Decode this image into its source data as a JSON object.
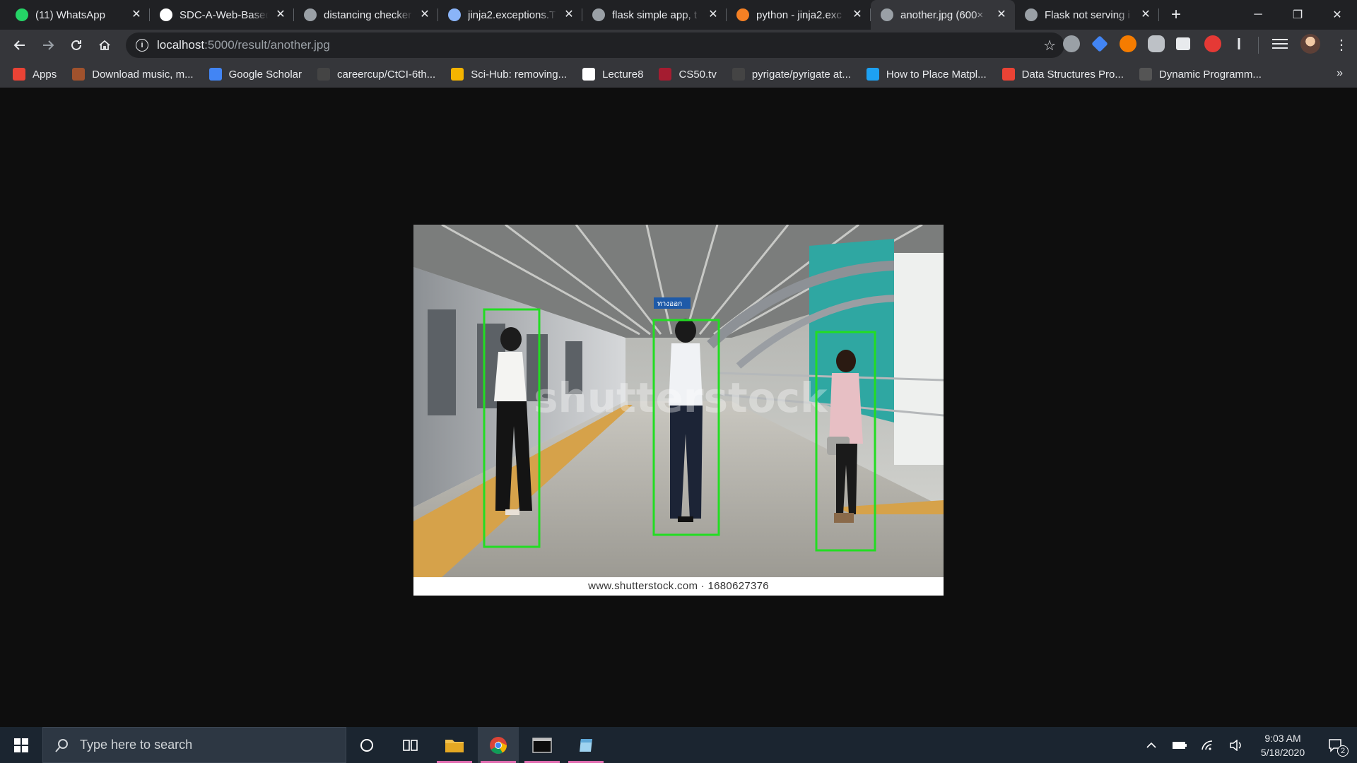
{
  "browser": {
    "tabs": [
      {
        "title": "(11) WhatsApp",
        "icon": "whatsapp-icon",
        "color": "#25d366"
      },
      {
        "title": "SDC-A-Web-Based",
        "icon": "github-icon",
        "color": "#ffffff"
      },
      {
        "title": "distancing checker",
        "icon": "globe-icon",
        "color": "#9aa0a6"
      },
      {
        "title": "jinja2.exceptions.T",
        "icon": "page-icon",
        "color": "#8ab4f8"
      },
      {
        "title": "flask simple app, t",
        "icon": "flask-icon",
        "color": "#9aa0a6"
      },
      {
        "title": "python - jinja2.exc",
        "icon": "stackoverflow-icon",
        "color": "#f48024"
      },
      {
        "title": "another.jpg (600×",
        "icon": "globe-icon",
        "color": "#9aa0a6",
        "active": true
      },
      {
        "title": "Flask not serving i",
        "icon": "flask-icon",
        "color": "#9aa0a6"
      }
    ],
    "new_tab": "+",
    "window_controls": {
      "minimize": "─",
      "restore": "❐",
      "close": "✕"
    },
    "address": {
      "host": "localhost",
      "path": ":5000/result/another.jpg"
    },
    "bookmarks": [
      {
        "label": "Apps",
        "icon": "apps-grid-icon",
        "color": "#ea4335"
      },
      {
        "label": "Download music, m...",
        "icon": "music-icon",
        "color": "#a0522d"
      },
      {
        "label": "Google Scholar",
        "icon": "scholar-icon",
        "color": "#4285f4"
      },
      {
        "label": "careercup/CtCI-6th...",
        "icon": "github-icon",
        "color": "#444444"
      },
      {
        "label": "Sci-Hub: removing...",
        "icon": "scihub-icon",
        "color": "#f4b400"
      },
      {
        "label": "Lecture8",
        "icon": "globe-icon",
        "color": "#ffffff"
      },
      {
        "label": "CS50.tv",
        "icon": "harvard-icon",
        "color": "#a51c30"
      },
      {
        "label": "pyrigate/pyrigate at...",
        "icon": "github-icon",
        "color": "#444444"
      },
      {
        "label": "How to Place Matpl...",
        "icon": "bird-icon",
        "color": "#1da1f2"
      },
      {
        "label": "Data Structures Pro...",
        "icon": "ds-icon",
        "color": "#ea4335"
      },
      {
        "label": "Dynamic Programm...",
        "icon": "dp-icon",
        "color": "#555555"
      }
    ],
    "bookmarks_more": "»"
  },
  "page": {
    "image_caption": "www.shutterstock.com · 1680627376",
    "watermark": "shutterstock",
    "sign_text": "ทางออก",
    "detections": 3
  },
  "taskbar": {
    "search_placeholder": "Type here to search",
    "time": "9:03 AM",
    "date": "5/18/2020",
    "notification_count": "2"
  }
}
